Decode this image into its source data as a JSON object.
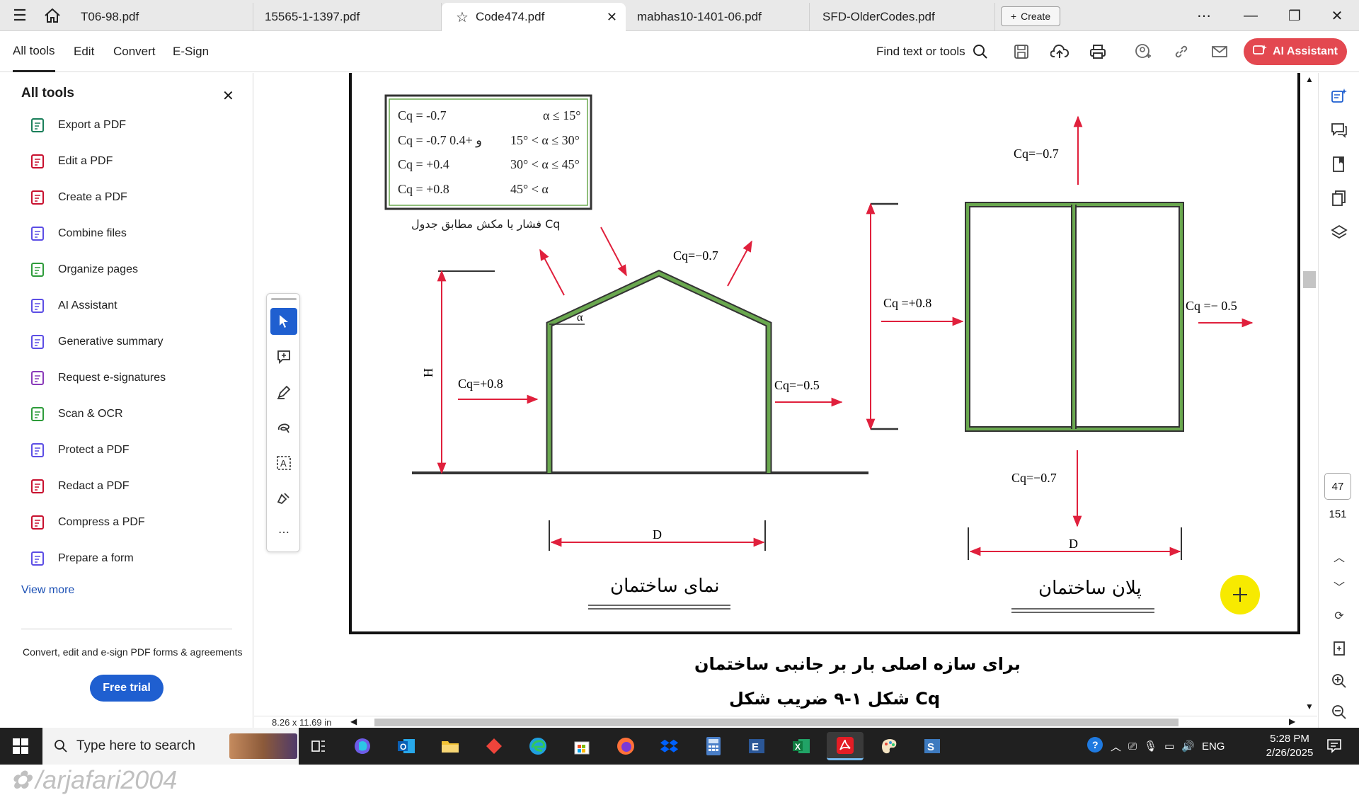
{
  "tabs": [
    {
      "label": "T06-98.pdf",
      "active": false
    },
    {
      "label": "15565-1-1397.pdf",
      "active": false
    },
    {
      "label": "Code474.pdf",
      "active": true
    },
    {
      "label": "mabhas10-1401-06.pdf",
      "active": false
    },
    {
      "label": "SFD-OlderCodes.pdf",
      "active": false
    }
  ],
  "create_label": "Create",
  "menu": {
    "all_tools": "All tools",
    "edit": "Edit",
    "convert": "Convert",
    "esign": "E-Sign"
  },
  "find_tools": "Find text or tools",
  "ai_assistant": "AI Assistant",
  "left_panel": {
    "title": "All tools",
    "items": [
      {
        "label": "Export a PDF",
        "icon": "export-icon",
        "color": "#1a7f5a"
      },
      {
        "label": "Edit a PDF",
        "icon": "edit-icon",
        "color": "#c8102e"
      },
      {
        "label": "Create a PDF",
        "icon": "create-pdf-icon",
        "color": "#c8102e"
      },
      {
        "label": "Combine files",
        "icon": "combine-icon",
        "color": "#5c4ee5"
      },
      {
        "label": "Organize pages",
        "icon": "organize-icon",
        "color": "#2d9b3a"
      },
      {
        "label": "AI Assistant",
        "icon": "ai-assistant-icon",
        "color": "#5c4ee5"
      },
      {
        "label": "Generative summary",
        "icon": "summary-icon",
        "color": "#5c4ee5"
      },
      {
        "label": "Request e-signatures",
        "icon": "signature-icon",
        "color": "#8a3ab9"
      },
      {
        "label": "Scan & OCR",
        "icon": "scan-icon",
        "color": "#2d9b3a"
      },
      {
        "label": "Protect a PDF",
        "icon": "protect-icon",
        "color": "#5c4ee5"
      },
      {
        "label": "Redact a PDF",
        "icon": "redact-icon",
        "color": "#c8102e"
      },
      {
        "label": "Compress a PDF",
        "icon": "compress-icon",
        "color": "#c8102e"
      },
      {
        "label": "Prepare a form",
        "icon": "form-icon",
        "color": "#5c4ee5"
      }
    ],
    "view_more": "View more",
    "promo": "Convert, edit and e-sign PDF forms & agreements",
    "free_trial": "Free trial",
    "watermark": "/arjafari2004"
  },
  "document": {
    "table_rows": [
      {
        "cq": "Cq = -0.7",
        "angle": "α ≤ 15°"
      },
      {
        "cq": "Cq = -0.7 و +0.4",
        "angle": "15° < α ≤ 30°"
      },
      {
        "cq": "Cq = +0.4",
        "angle": "30° < α ≤ 45°"
      },
      {
        "cq": "Cq = +0.8",
        "angle": "45° < α"
      }
    ],
    "table_caption": "فشار یا مکش مطابق جدول Cq",
    "elev_roof_label": "Cq=−0.7",
    "elev_windward": "Cq=+0.8",
    "elev_leeward": "Cq=−0.5",
    "elev_height": "H",
    "elev_alpha": "α",
    "elev_width": "D",
    "elev_title": "نمای ساختمان",
    "plan_top": "Cq=−0.7",
    "plan_windward": "Cq =+0.8",
    "plan_leeward": "Cq =− 0.5",
    "plan_bottom": "Cq=−0.7",
    "plan_width": "D",
    "plan_title": "پلان ساختمان",
    "caption_line1": "برای سازه اصلی بار بر جانبی ساختمان",
    "caption_line2": "شکل ۱-۹ ضریب شکل Cq"
  },
  "page_current": "47",
  "page_total": "151",
  "page_size": "8.26 x 11.69 in",
  "taskbar": {
    "search_placeholder": "Type here to search",
    "lang": "ENG",
    "time": "5:28 PM",
    "date": "2/26/2025"
  },
  "colors": {
    "accent_red": "#e34850",
    "arrow_red": "#e0203c",
    "wall_green": "#6aa84f",
    "blue": "#1f5fd0"
  }
}
